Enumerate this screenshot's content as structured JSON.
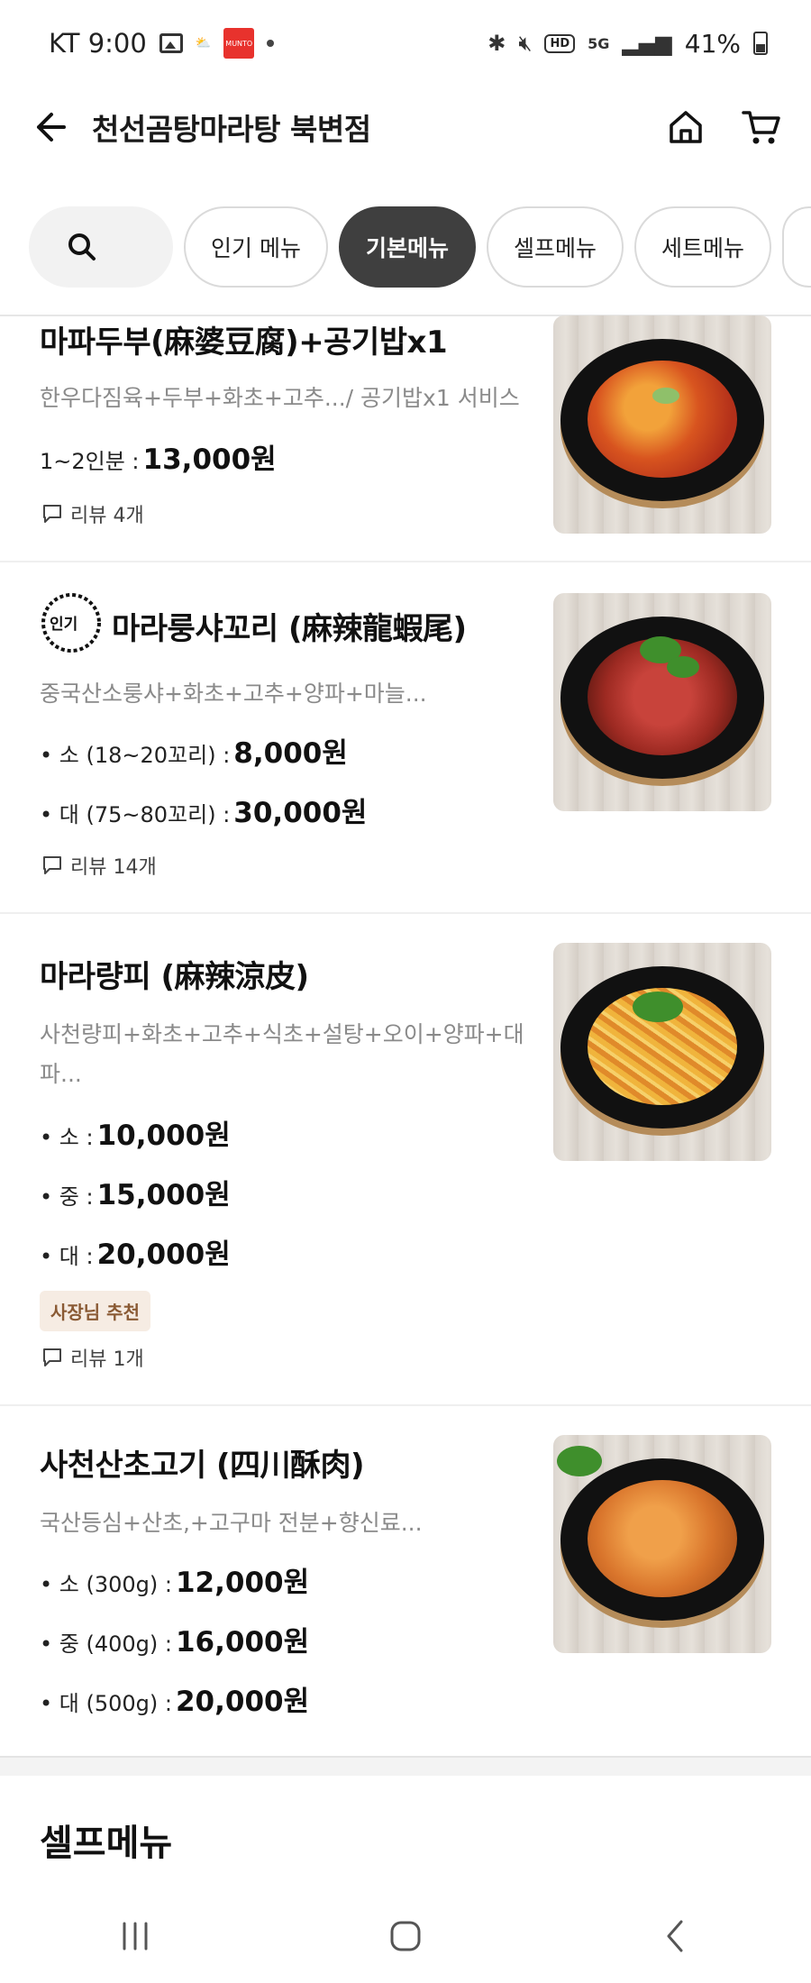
{
  "status_bar": {
    "carrier_time": "KT 9:00",
    "app_chip_1": "MUNTO",
    "battery": "41%"
  },
  "header": {
    "title": "천선곰탕마라탕 북변점"
  },
  "tabs": [
    {
      "label": "인기 메뉴"
    },
    {
      "label": "기본메뉴"
    },
    {
      "label": "셀프메뉴"
    },
    {
      "label": "세트메뉴"
    }
  ],
  "items": [
    {
      "name": "마파두부(麻婆豆腐)+공기밥x1",
      "desc": "한우다짐육+두부+화초+고추.../ 공기밥x1 서비스",
      "prices": [
        {
          "label": "1~2인분 : ",
          "price": "13,000원"
        }
      ],
      "review": "리뷰 4개"
    },
    {
      "badge": "인기",
      "name": "마라룽샤꼬리 (麻辣龍蝦尾)",
      "desc": "중국산소룽샤+화초+고추+양파+마늘...",
      "prices": [
        {
          "label": "• 소 (18~20꼬리) : ",
          "price": "8,000원"
        },
        {
          "label": "• 대 (75~80꼬리) : ",
          "price": "30,000원"
        }
      ],
      "review": "리뷰 14개"
    },
    {
      "name": "마라량피 (麻辣涼皮)",
      "desc": "사천량피+화초+고추+식초+설탕+오이+양파+대파...",
      "prices": [
        {
          "label": "• 소 : ",
          "price": "10,000원"
        },
        {
          "label": "• 중 : ",
          "price": "15,000원"
        },
        {
          "label": "• 대 : ",
          "price": "20,000원"
        }
      ],
      "owner_badge": "사장님 추천",
      "review": "리뷰 1개"
    },
    {
      "name": "사천산초고기 (四川酥肉)",
      "desc": "국산등심+산초,+고구마 전분+향신료...",
      "prices": [
        {
          "label": "• 소 (300g) : ",
          "price": "12,000원"
        },
        {
          "label": "• 중 (400g) : ",
          "price": "16,000원"
        },
        {
          "label": "• 대 (500g) : ",
          "price": "20,000원"
        }
      ]
    }
  ],
  "next_section": {
    "title": "셀프메뉴"
  },
  "colors": {
    "active_tab": "#3f3f3f",
    "owner_badge_bg": "#f6ece3",
    "owner_badge_text": "#8a5a34"
  }
}
